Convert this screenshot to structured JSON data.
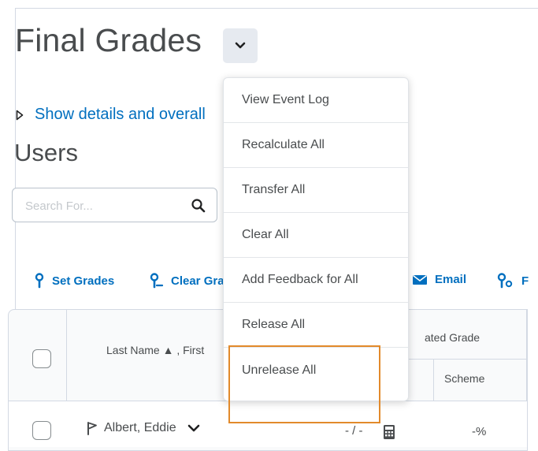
{
  "header": {
    "title": "Final Grades"
  },
  "details_toggle": {
    "label": "Show details and overall"
  },
  "users_heading": "Users",
  "search": {
    "placeholder": "Search For..."
  },
  "toolbar": {
    "set_grades": "Set Grades",
    "clear_grades": "Clear Gra",
    "email": "Email",
    "next": "F"
  },
  "grid": {
    "name_header": "Last Name ▲ , First",
    "group_header": "ated Grade",
    "scheme_header": "Scheme",
    "rows": [
      {
        "name": "Albert, Eddie",
        "points": "- / -",
        "scheme": "-%"
      }
    ]
  },
  "title_menu": {
    "items": [
      "View Event Log",
      "Recalculate All",
      "Transfer All",
      "Clear All",
      "Add Feedback for All",
      "Release All",
      "Unrelease All"
    ]
  },
  "colors": {
    "link": "#006fbf",
    "text": "#494c4e",
    "highlight": "#e28a2b",
    "border": "#d3d9e3"
  },
  "icons": [
    "chevron-down-icon",
    "caret-right-icon",
    "search-icon",
    "set-grades-icon",
    "clear-grades-icon",
    "email-icon",
    "flag-icon",
    "calculator-icon"
  ]
}
